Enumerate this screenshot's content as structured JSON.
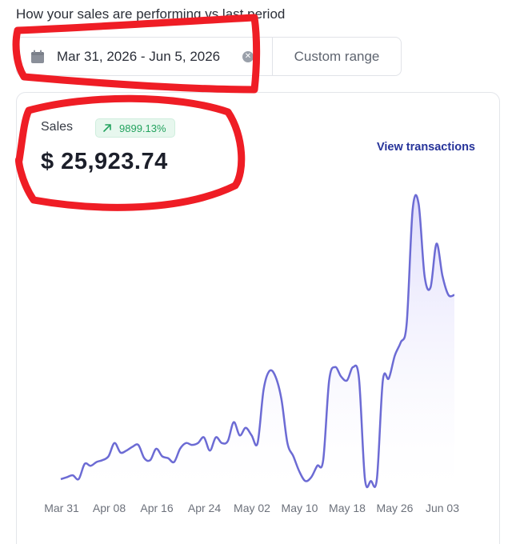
{
  "header": {
    "subtitle": "How your sales are performing vs last period"
  },
  "range_control": {
    "date_range": "Mar 31, 2026 - Jun 5, 2026",
    "custom_range_label": "Custom range"
  },
  "card": {
    "label": "Sales",
    "change_badge": "9899.13%",
    "value": "$ 25,923.74",
    "view_link": "View transactions"
  },
  "colors": {
    "line": "#6c6bd4",
    "area_top": "#dcd9fb",
    "badge_text": "#24a35f",
    "link": "#27349a",
    "annotation": "#ef1d25"
  },
  "icons": {
    "calendar": "calendar-icon",
    "clear": "clear-icon",
    "trend": "arrow-up-right-icon"
  },
  "chart_data": {
    "type": "area",
    "x_tick_labels": [
      "Mar 31",
      "Apr 08",
      "Apr 16",
      "Apr 24",
      "May 02",
      "May 10",
      "May 18",
      "May 26",
      "Jun 03"
    ],
    "x": [
      "Mar 31",
      "Apr 01",
      "Apr 02",
      "Apr 03",
      "Apr 04",
      "Apr 05",
      "Apr 06",
      "Apr 07",
      "Apr 08",
      "Apr 09",
      "Apr 10",
      "Apr 11",
      "Apr 12",
      "Apr 13",
      "Apr 14",
      "Apr 15",
      "Apr 16",
      "Apr 17",
      "Apr 18",
      "Apr 19",
      "Apr 20",
      "Apr 21",
      "Apr 22",
      "Apr 23",
      "Apr 24",
      "Apr 25",
      "Apr 26",
      "Apr 27",
      "Apr 28",
      "Apr 29",
      "Apr 30",
      "May 01",
      "May 02",
      "May 03",
      "May 04",
      "May 05",
      "May 06",
      "May 07",
      "May 08",
      "May 09",
      "May 10",
      "May 11",
      "May 12",
      "May 13",
      "May 14",
      "May 15",
      "May 16",
      "May 17",
      "May 18",
      "May 19",
      "May 20",
      "May 21",
      "May 22",
      "May 23",
      "May 24",
      "May 25",
      "May 26",
      "May 27",
      "May 28",
      "May 29",
      "May 30",
      "May 31",
      "Jun 01",
      "Jun 02",
      "Jun 03",
      "Jun 04",
      "Jun 05"
    ],
    "series": [
      {
        "values": [
          3,
          4,
          5,
          3,
          11,
          10,
          12,
          13,
          15,
          22,
          17,
          18,
          20,
          21,
          14,
          13,
          19,
          15,
          14,
          12,
          19,
          22,
          21,
          22,
          25,
          18,
          25,
          22,
          23,
          33,
          26,
          30,
          26,
          22,
          50,
          60,
          57,
          45,
          22,
          15,
          7,
          2,
          4,
          10,
          13,
          55,
          62,
          57,
          55,
          62,
          56,
          3,
          2,
          3,
          55,
          56,
          68,
          75,
          85,
          145,
          148,
          110,
          104,
          127,
          110,
          100,
          100
        ]
      }
    ],
    "ylim": [
      0,
      150
    ],
    "grid": false,
    "legend": "none"
  }
}
